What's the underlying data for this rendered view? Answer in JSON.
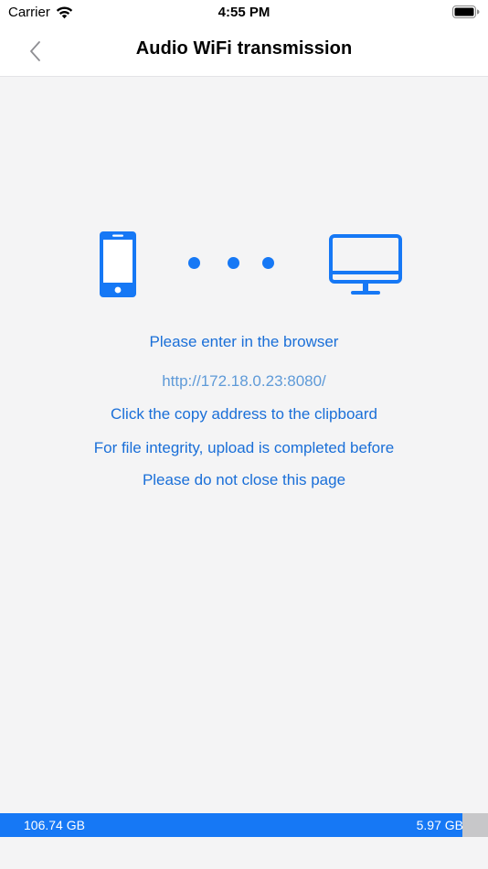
{
  "status_bar": {
    "carrier": "Carrier",
    "time": "4:55 PM",
    "wifi_icon": "wifi-icon",
    "battery_icon": "battery-icon"
  },
  "nav": {
    "back_icon": "chevron-left-icon",
    "title": "Audio WiFi transmission"
  },
  "illustration": {
    "left_icon": "smartphone-icon",
    "middle_icon": "three-dots-icon",
    "right_icon": "monitor-icon"
  },
  "instructions": {
    "line1": "Please enter in the browser",
    "url": "http://172.18.0.23:8080/",
    "line3": "Click the copy address to the clipboard",
    "line4": "For file integrity, upload is completed before",
    "line5": "Please do not close this page"
  },
  "storage": {
    "free": "106.74 GB",
    "used": "5.97 GB",
    "used_fraction": 0.053
  },
  "colors": {
    "accent": "#1678f5",
    "text_blue": "#1a6fd8",
    "url_blue": "#5e9ad8",
    "background": "#f4f4f5",
    "used_gray": "#c7c7c9"
  }
}
